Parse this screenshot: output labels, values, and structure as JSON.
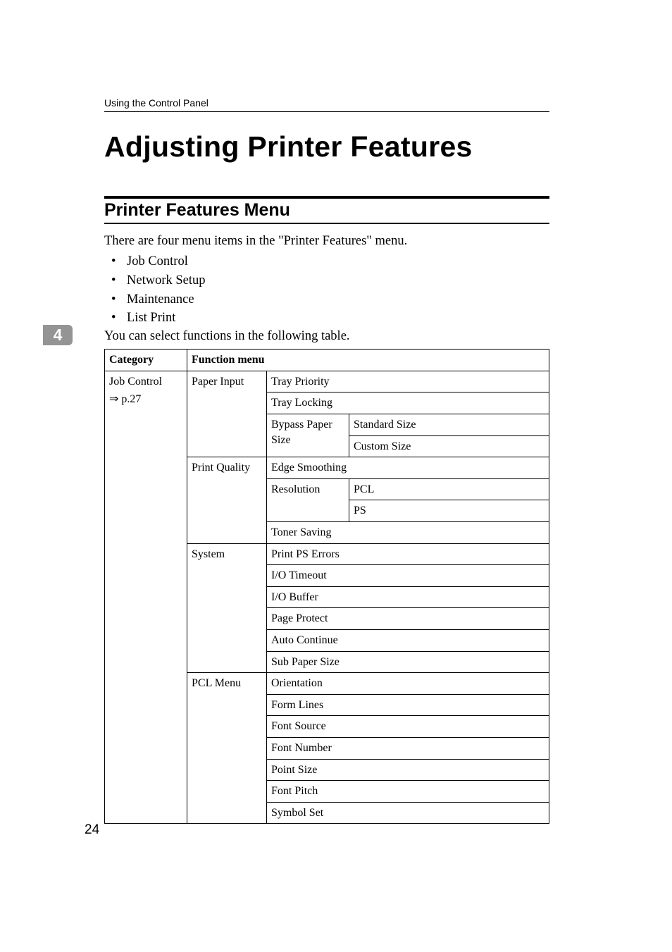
{
  "header": {
    "section": "Using the Control Panel"
  },
  "headings": {
    "h1": "Adjusting Printer Features",
    "h2": "Printer Features Menu"
  },
  "text": {
    "intro": "There are four menu items in the \"Printer Features\" menu.",
    "after_list": "You can select functions in the following table."
  },
  "bullets": {
    "b1": "Job Control",
    "b2": "Network Setup",
    "b3": "Maintenance",
    "b4": "List Print"
  },
  "chapter": "4",
  "table": {
    "hdr_category": "Category",
    "hdr_function": "Function menu",
    "cat_jobcontrol": "Job Control",
    "cat_jobcontrol_ref": "⇒ p.27",
    "fm_paperinput": "Paper Input",
    "fm_printquality": "Print Quality",
    "fm_system": "System",
    "fm_pclmenu": "PCL Menu",
    "tray_priority": "Tray Priority",
    "tray_locking": "Tray Locking",
    "bypass_paper_size": "Bypass Paper Size",
    "standard_size": "Standard Size",
    "custom_size": "Custom Size",
    "edge_smoothing": "Edge Smoothing",
    "resolution": "Resolution",
    "pcl": "PCL",
    "ps": "PS",
    "toner_saving": "Toner Saving",
    "print_ps_errors": "Print PS Errors",
    "io_timeout": "I/O Timeout",
    "io_buffer": "I/O Buffer",
    "page_protect": "Page Protect",
    "auto_continue": "Auto Continue",
    "sub_paper_size": "Sub Paper Size",
    "orientation": "Orientation",
    "form_lines": "Form Lines",
    "font_source": "Font Source",
    "font_number": "Font Number",
    "point_size": "Point Size",
    "font_pitch": "Font Pitch",
    "symbol_set": "Symbol Set"
  },
  "page_number": "24"
}
